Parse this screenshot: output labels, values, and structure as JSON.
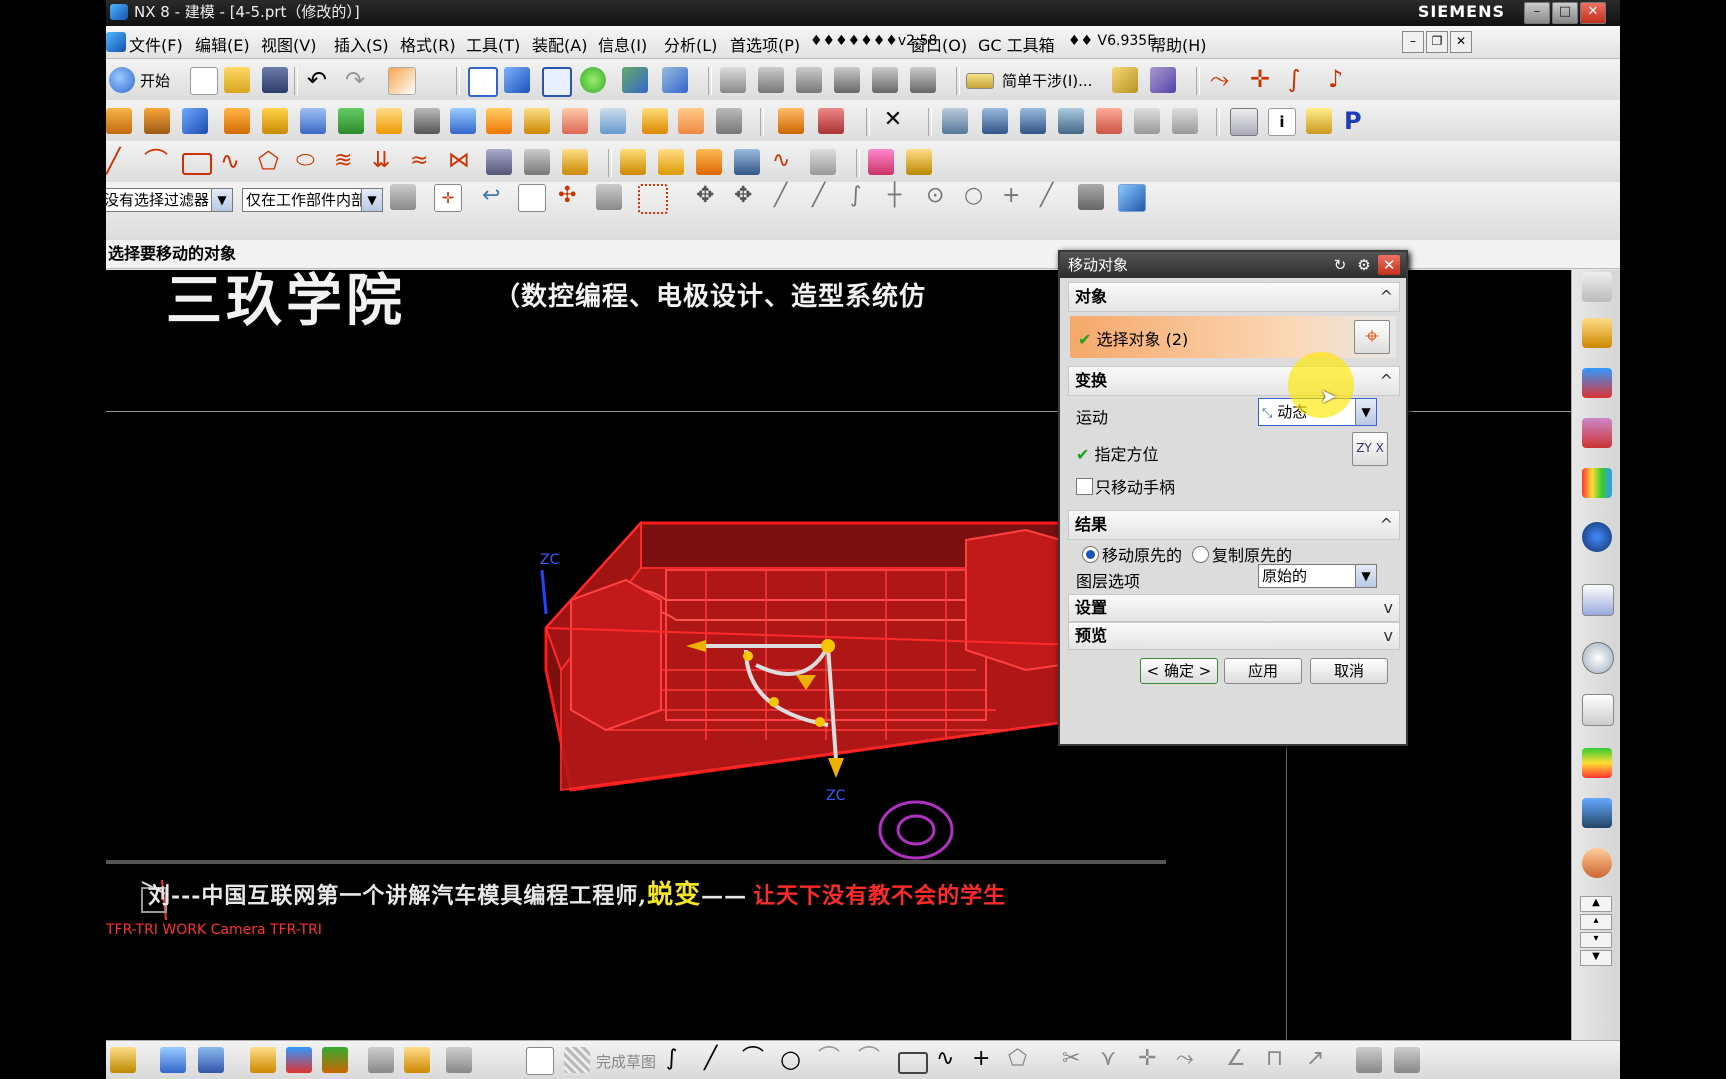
{
  "window": {
    "title": "NX 8 - 建模 - [4-5.prt（修改的）]",
    "brand": "SIEMENS",
    "min": "–",
    "max": "□",
    "close": "✕"
  },
  "menu": {
    "items": [
      "文件(F)",
      "编辑(E)",
      "视图(V)",
      "插入(S)",
      "格式(R)",
      "工具(T)",
      "装配(A)",
      "信息(I)",
      "分析(L)",
      "首选项(P)",
      "♦♦♦♦♦♦♦v2.58",
      "窗口(O)",
      "GC 工具箱",
      "♦♦ V6.935F",
      "帮助(H)"
    ]
  },
  "toolbar": {
    "start_label": "开始",
    "simple_step_label": "简单干涉(I)..."
  },
  "selection": {
    "filter": "没有选择过滤器",
    "scope": "仅在工作部件内部"
  },
  "cue_line": "选择要移动的对象",
  "viewport": {
    "banner_title": "三玖学院",
    "banner_sub": "（数控编程、电极设计、造型系统仿",
    "ticker_white": "刘---中国互联网第一个讲解汽车模具编程工程师,",
    "ticker_yellow": "蜕变",
    "ticker_dash": "——",
    "ticker_red": "让天下没有教不会的学生",
    "view_label": "TFR-TRI WORK Camera TFR-TRI",
    "zc_top": "ZC",
    "zc_bottom": "ZC"
  },
  "dialog": {
    "title": "移动对象",
    "group_object": "对象",
    "select_object": "选择对象 (2)",
    "group_transform": "变换",
    "motion_label": "运动",
    "motion_value": "动态",
    "specify_orientation": "指定方位",
    "move_handle_only": "只移动手柄",
    "group_result": "结果",
    "move_original": "移动原先的",
    "copy_original": "复制原先的",
    "layer_option_label": "图层选项",
    "layer_option_value": "原始的",
    "group_settings": "设置",
    "group_preview": "预览",
    "ok": "< 确定 >",
    "apply": "应用",
    "cancel": "取消"
  },
  "bottom": {
    "finish_sketch": "完成草图"
  }
}
